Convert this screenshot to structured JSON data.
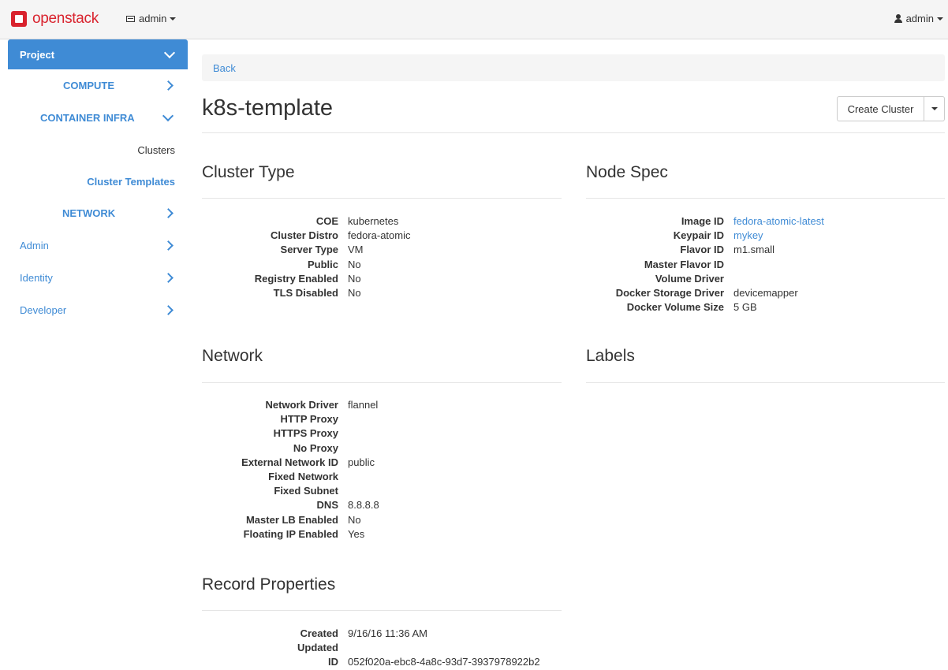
{
  "topbar": {
    "brand": "openstack",
    "project_selector": "admin",
    "user_menu": "admin"
  },
  "sidebar": {
    "project": "Project",
    "groups": {
      "compute": "COMPUTE",
      "container_infra": "CONTAINER INFRA",
      "network": "NETWORK"
    },
    "container_infra_items": {
      "clusters": "Clusters",
      "cluster_templates": "Cluster Templates"
    },
    "top_items": {
      "admin": "Admin",
      "identity": "Identity",
      "developer": "Developer"
    }
  },
  "breadcrumb": {
    "back": "Back"
  },
  "page": {
    "title": "k8s-template",
    "create_cluster_button": "Create Cluster"
  },
  "cluster_type": {
    "heading": "Cluster Type",
    "rows": [
      {
        "label": "COE",
        "value": "kubernetes"
      },
      {
        "label": "Cluster Distro",
        "value": "fedora-atomic"
      },
      {
        "label": "Server Type",
        "value": "VM"
      },
      {
        "label": "Public",
        "value": "No"
      },
      {
        "label": "Registry Enabled",
        "value": "No"
      },
      {
        "label": "TLS Disabled",
        "value": "No"
      }
    ]
  },
  "node_spec": {
    "heading": "Node Spec",
    "rows": [
      {
        "label": "Image ID",
        "value": "fedora-atomic-latest",
        "link": true
      },
      {
        "label": "Keypair ID",
        "value": "mykey",
        "link": true
      },
      {
        "label": "Flavor ID",
        "value": "m1.small"
      },
      {
        "label": "Master Flavor ID",
        "value": ""
      },
      {
        "label": "Volume Driver",
        "value": ""
      },
      {
        "label": "Docker Storage Driver",
        "value": "devicemapper"
      },
      {
        "label": "Docker Volume Size",
        "value": "5 GB"
      }
    ]
  },
  "network": {
    "heading": "Network",
    "rows": [
      {
        "label": "Network Driver",
        "value": "flannel"
      },
      {
        "label": "HTTP Proxy",
        "value": ""
      },
      {
        "label": "HTTPS Proxy",
        "value": ""
      },
      {
        "label": "No Proxy",
        "value": ""
      },
      {
        "label": "External Network ID",
        "value": "public"
      },
      {
        "label": "Fixed Network",
        "value": ""
      },
      {
        "label": "Fixed Subnet",
        "value": ""
      },
      {
        "label": "DNS",
        "value": "8.8.8.8"
      },
      {
        "label": "Master LB Enabled",
        "value": "No"
      },
      {
        "label": "Floating IP Enabled",
        "value": "Yes"
      }
    ]
  },
  "labels": {
    "heading": "Labels"
  },
  "record_properties": {
    "heading": "Record Properties",
    "rows": [
      {
        "label": "Created",
        "value": "9/16/16 11:36 AM"
      },
      {
        "label": "Updated",
        "value": ""
      },
      {
        "label": "ID",
        "value": "052f020a-ebc8-4a8c-93d7-3937978922b2"
      }
    ]
  },
  "colors": {
    "accent": "#3f8bd5",
    "brand": "#d9232e"
  }
}
